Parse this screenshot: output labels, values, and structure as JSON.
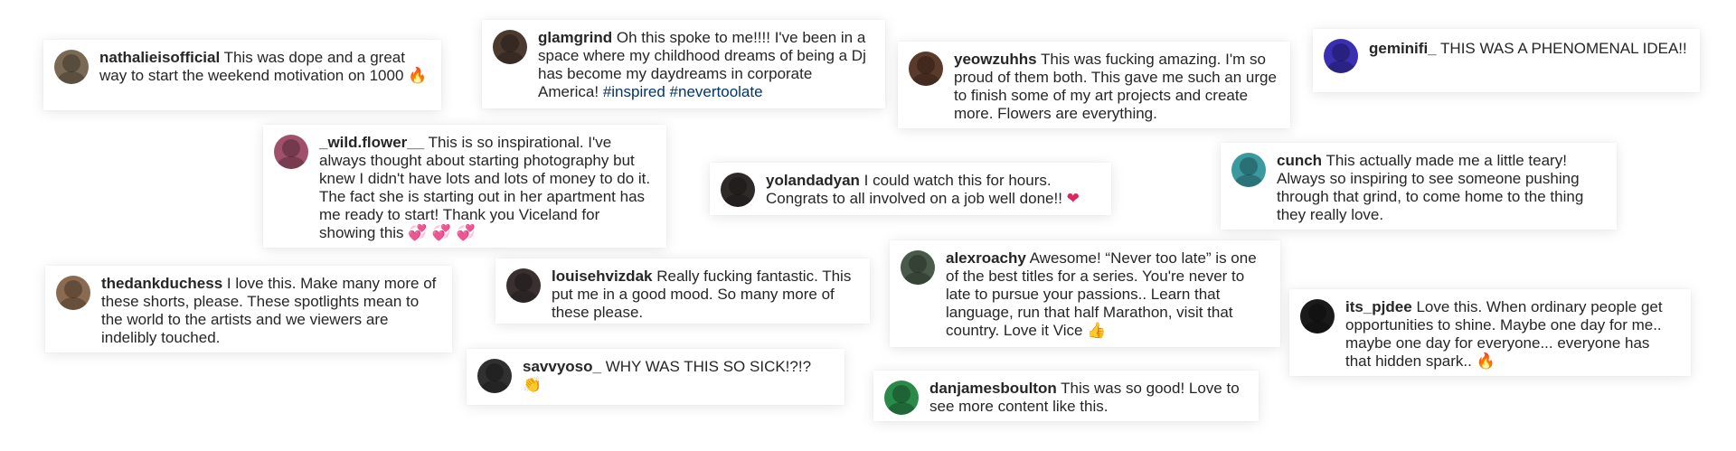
{
  "comments": [
    {
      "username": "nathalieisofficial",
      "text": "This was dope and a great way to start the weekend motivation on 1000",
      "emoji": "🔥",
      "avatar_color": "#7a6a55"
    },
    {
      "username": "glamgrind",
      "text": "Oh this spoke to me!!!! I've been in a space where my childhood dreams of being a Dj has become my daydreams in corporate America!",
      "hashtags": [
        "#inspired",
        "#nevertoolate"
      ],
      "avatar_color": "#4a3a30"
    },
    {
      "username": "yeowzuhhs",
      "text": "This was fucking amazing. I'm so proud of them both. This gave me such an urge to finish some of my art projects and create more. Flowers are everything.",
      "avatar_color": "#5a3a2a"
    },
    {
      "username": "geminifi_",
      "text": "THIS WAS A PHENOMENAL IDEA!!",
      "avatar_color": "#3a2fb0"
    },
    {
      "username": "_wild.flower__",
      "text": "This is so inspirational. I've always thought about starting photography but knew I didn't have lots and lots of money to do it. The fact she is starting out in her apartment has me ready to start! Thank you Viceland for showing this",
      "emoji": "💞 💞 💞",
      "avatar_color": "#a0506a"
    },
    {
      "username": "yolandadyan",
      "text": "I could watch this for hours. Congrats to all involved on a job well done!!",
      "emoji": "❤",
      "avatar_color": "#2e2a28"
    },
    {
      "username": "cunch",
      "text": "This actually made me a little teary! Always so inspiring to see someone pushing through that grind, to come home to the thing they really love.",
      "avatar_color": "#3a9aa0"
    },
    {
      "username": "thedankduchess",
      "text": "I love this.  Make many more of these shorts, please.  These spotlights mean to the world to the artists and we viewers are indelibly touched.",
      "avatar_color": "#8a6a50"
    },
    {
      "username": "louisehvizdak",
      "text": "Really fucking fantastic. This put me in a good mood. So many more of these please.",
      "avatar_color": "#3a3030"
    },
    {
      "username": "alexroachy",
      "text": "Awesome! “Never too late” is one of the best titles for a series. You're never to late to pursue your passions.. Learn that language, run that half Marathon, visit that country. Love it Vice",
      "emoji": "👍",
      "avatar_color": "#4a5a4a"
    },
    {
      "username": "its_pjdee",
      "text": "Love this. When ordinary people get opportunities to shine. Maybe one day for me.. maybe one day for everyone... everyone has that hidden spark..",
      "emoji": "🔥",
      "avatar_color": "#1a1a1a"
    },
    {
      "username": "savvyoso_",
      "text": "WHY WAS THIS SO SICK!?!?",
      "emoji": "👏",
      "avatar_color": "#303030"
    },
    {
      "username": "danjamesboulton",
      "text": "This was so good! Love to see more content like this.",
      "avatar_color": "#2a8a4a"
    }
  ]
}
